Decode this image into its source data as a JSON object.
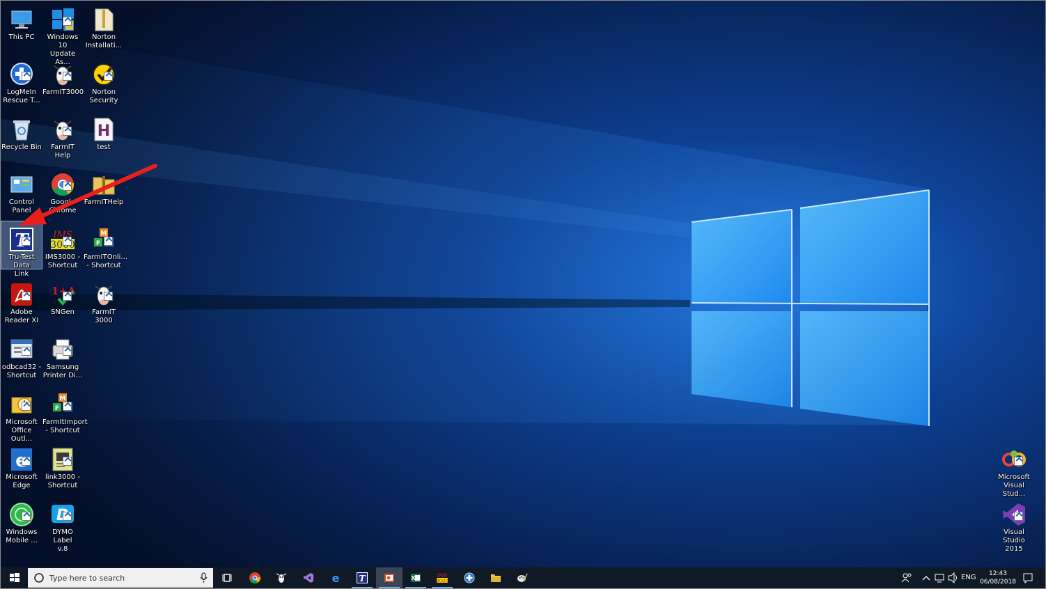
{
  "desktop_icons": [
    {
      "id": "this-pc",
      "line1": "This PC",
      "line2": ""
    },
    {
      "id": "win10-update",
      "line1": "Windows 10",
      "line2": "Update As..."
    },
    {
      "id": "norton-install",
      "line1": "Norton",
      "line2": "Installati..."
    },
    {
      "id": "logmein",
      "line1": "LogMeIn",
      "line2": "Rescue T..."
    },
    {
      "id": "farmit3000-a",
      "line1": "FarmIT3000",
      "line2": ""
    },
    {
      "id": "norton-security",
      "line1": "Norton",
      "line2": "Security"
    },
    {
      "id": "recycle-bin",
      "line1": "Recycle Bin",
      "line2": ""
    },
    {
      "id": "farmit-help",
      "line1": "FarmIT Help",
      "line2": ""
    },
    {
      "id": "test",
      "line1": "test",
      "line2": ""
    },
    {
      "id": "control-panel",
      "line1": "Control Panel",
      "line2": ""
    },
    {
      "id": "google-chrome",
      "line1": "Google",
      "line2": "Chrome"
    },
    {
      "id": "farmithelp-folder",
      "line1": "FarmITHelp",
      "line2": ""
    },
    {
      "id": "tru-test",
      "line1": "Tru-Test Data",
      "line2": "Link"
    },
    {
      "id": "ims3000",
      "line1": "IMS3000 -",
      "line2": "Shortcut"
    },
    {
      "id": "farmitonline",
      "line1": "FarmITOnli...",
      "line2": "- Shortcut"
    },
    {
      "id": "adobe-reader",
      "line1": "Adobe",
      "line2": "Reader XI"
    },
    {
      "id": "sngen",
      "line1": "SNGen",
      "line2": ""
    },
    {
      "id": "farmit-3000-b",
      "line1": "FarmIT 3000",
      "line2": ""
    },
    {
      "id": "odbcad32",
      "line1": "odbcad32 -",
      "line2": "Shortcut"
    },
    {
      "id": "samsung-printer",
      "line1": "Samsung",
      "line2": "Printer Di..."
    },
    {
      "id": "ms-outlook",
      "line1": "Microsoft",
      "line2": "Office Outl..."
    },
    {
      "id": "farmitimport",
      "line1": "FarmItImport",
      "line2": "- Shortcut"
    },
    {
      "id": "ms-edge",
      "line1": "Microsoft",
      "line2": "Edge"
    },
    {
      "id": "link3000",
      "line1": "link3000 -",
      "line2": "Shortcut"
    },
    {
      "id": "windows-mobile",
      "line1": "Windows",
      "line2": "Mobile ..."
    },
    {
      "id": "dymo-label",
      "line1": "DYMO Label",
      "line2": "v.8"
    },
    {
      "id": "ms-visual-studio",
      "line1": "Microsoft",
      "line2": "Visual Stud..."
    },
    {
      "id": "visual-studio-2015",
      "line1": "Visual Studio",
      "line2": "2015"
    }
  ],
  "taskbar": {
    "search_placeholder": "Type here to search",
    "apps": [
      {
        "name": "task-view",
        "icon": "task-view-icon",
        "state": "none"
      },
      {
        "name": "chrome",
        "icon": "chrome-icon",
        "state": "none"
      },
      {
        "name": "farmit",
        "icon": "cow-icon",
        "state": "none"
      },
      {
        "name": "visual-studio",
        "icon": "visual-studio-icon",
        "state": "none"
      },
      {
        "name": "edge",
        "icon": "edge-icon",
        "state": "none"
      },
      {
        "name": "tru-test",
        "icon": "tru-test-icon",
        "state": "running"
      },
      {
        "name": "powerpoint",
        "icon": "powerpoint-icon",
        "state": "active"
      },
      {
        "name": "excel",
        "icon": "excel-icon",
        "state": "running"
      },
      {
        "name": "ims3000",
        "icon": "ims3000-icon",
        "state": "running"
      },
      {
        "name": "logmein",
        "icon": "logmein-icon",
        "state": "none"
      },
      {
        "name": "file-explorer",
        "icon": "folder-icon",
        "state": "none"
      },
      {
        "name": "paint",
        "icon": "paint-icon",
        "state": "none"
      }
    ],
    "tray": {
      "language": "ENG",
      "time": "12:43",
      "date": "06/08/2018"
    }
  },
  "colors": {
    "accent": "#2aa7ff",
    "annotation_arrow": "#e8201b",
    "taskbar": "#0f1a26"
  }
}
